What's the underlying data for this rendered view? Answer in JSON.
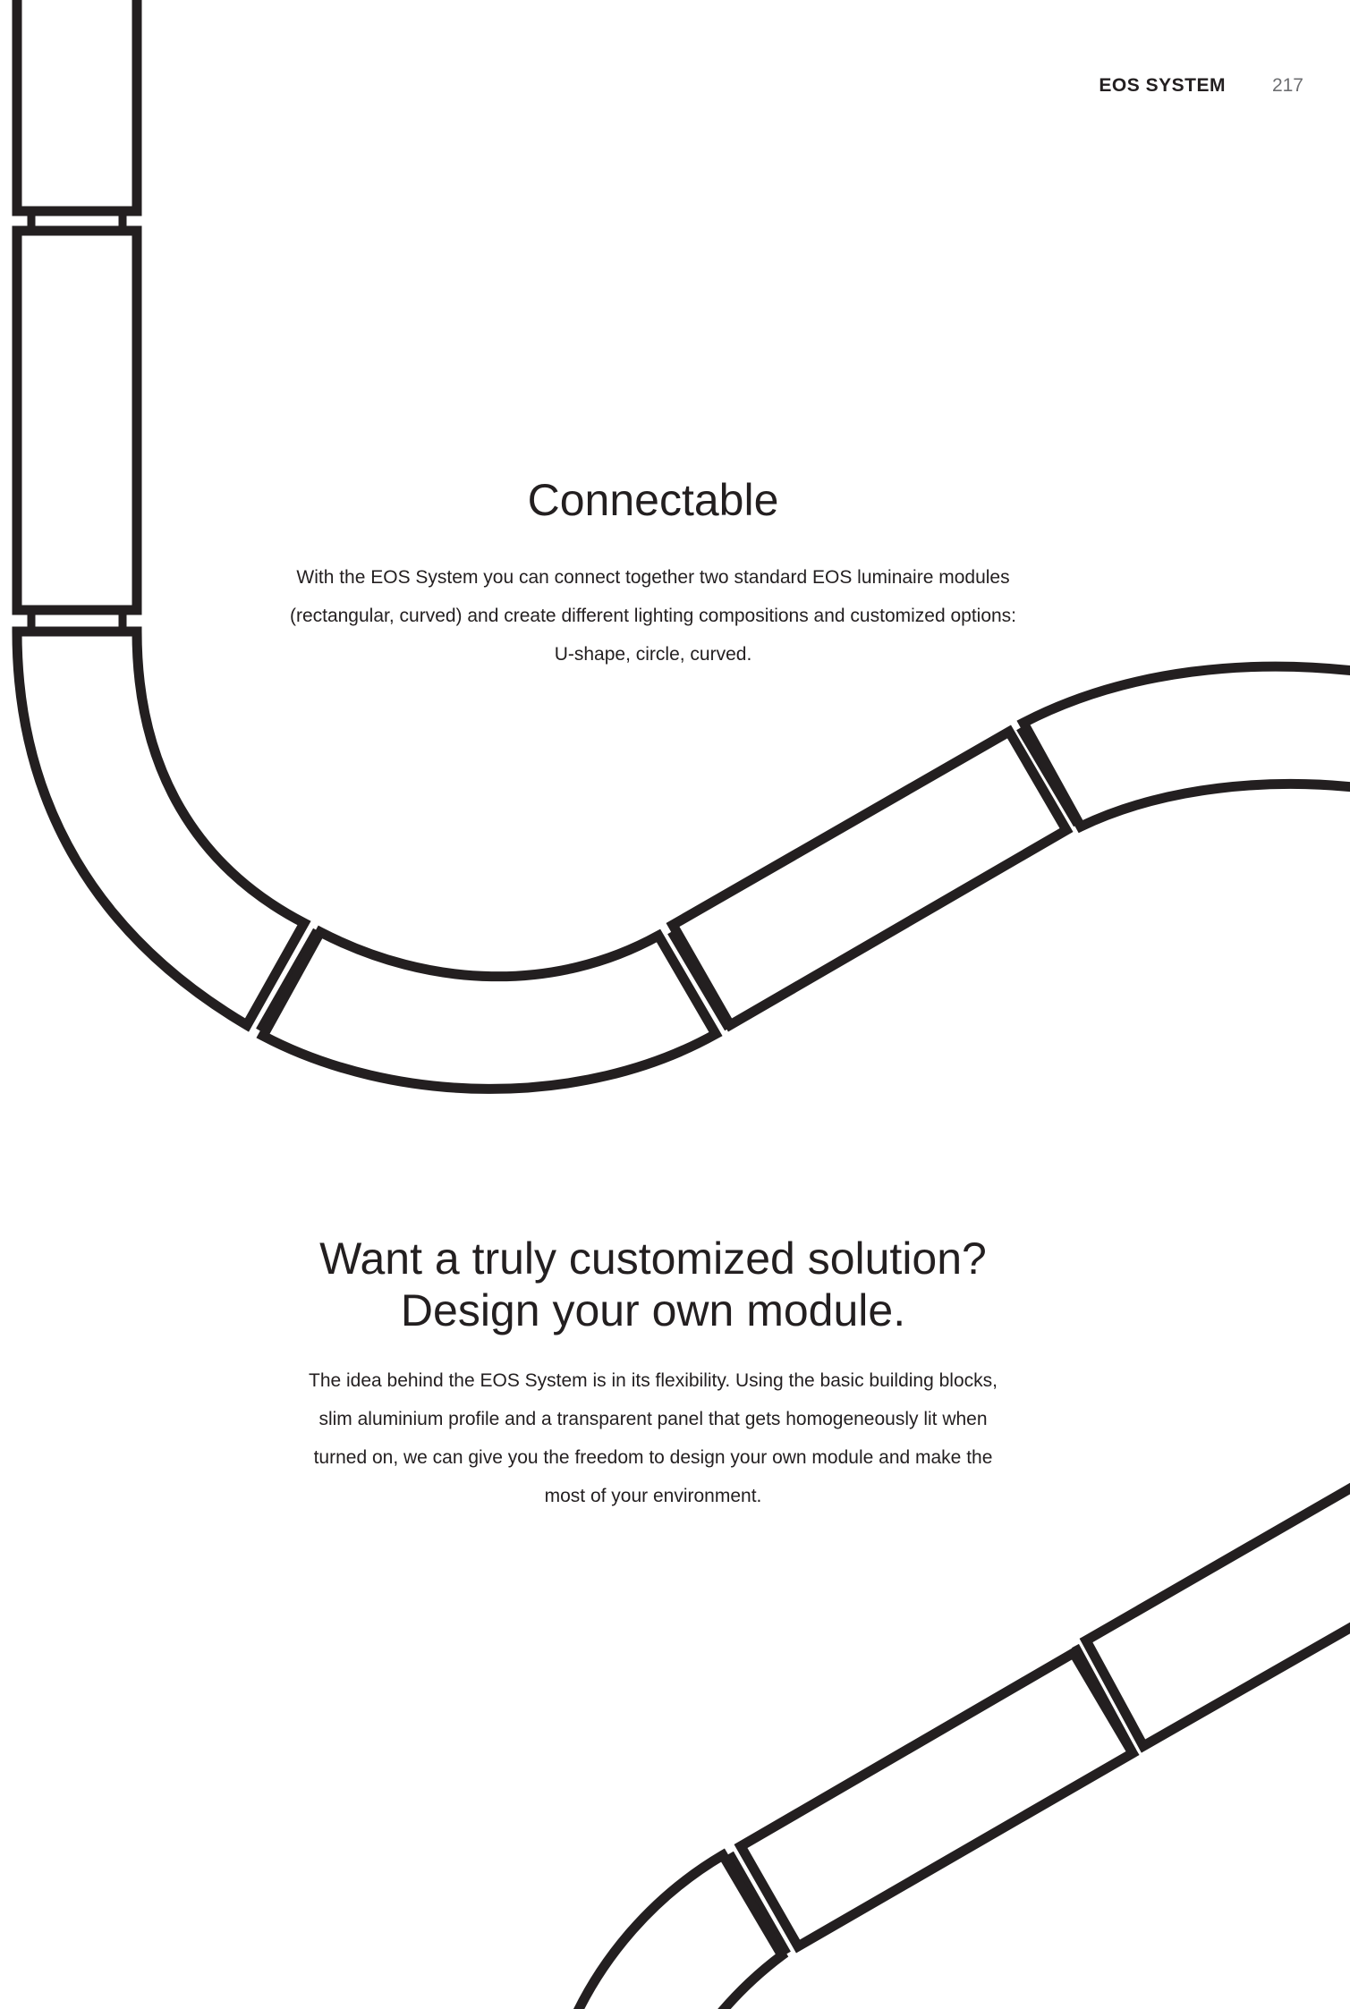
{
  "header": {
    "title": "EOS SYSTEM",
    "page_number": "217"
  },
  "sections": [
    {
      "heading": "Connectable",
      "body": "With the EOS System you can connect together two standard EOS luminaire modules (rectangular, curved) and create different lighting compositions and customized options: U-shape, circle, curved."
    },
    {
      "heading_lines": [
        "Want a truly customized solution?",
        "Design your own module."
      ],
      "body": "The idea behind the EOS System is in its flexibility. Using the basic building blocks, slim aluminium profile and a transparent panel that gets homogeneously lit when turned on, we can give you the freedom to design your own module and make the most of your environment."
    }
  ],
  "colors": {
    "ink": "#231f20",
    "muted": "#6d6e71",
    "background": "#ffffff"
  }
}
